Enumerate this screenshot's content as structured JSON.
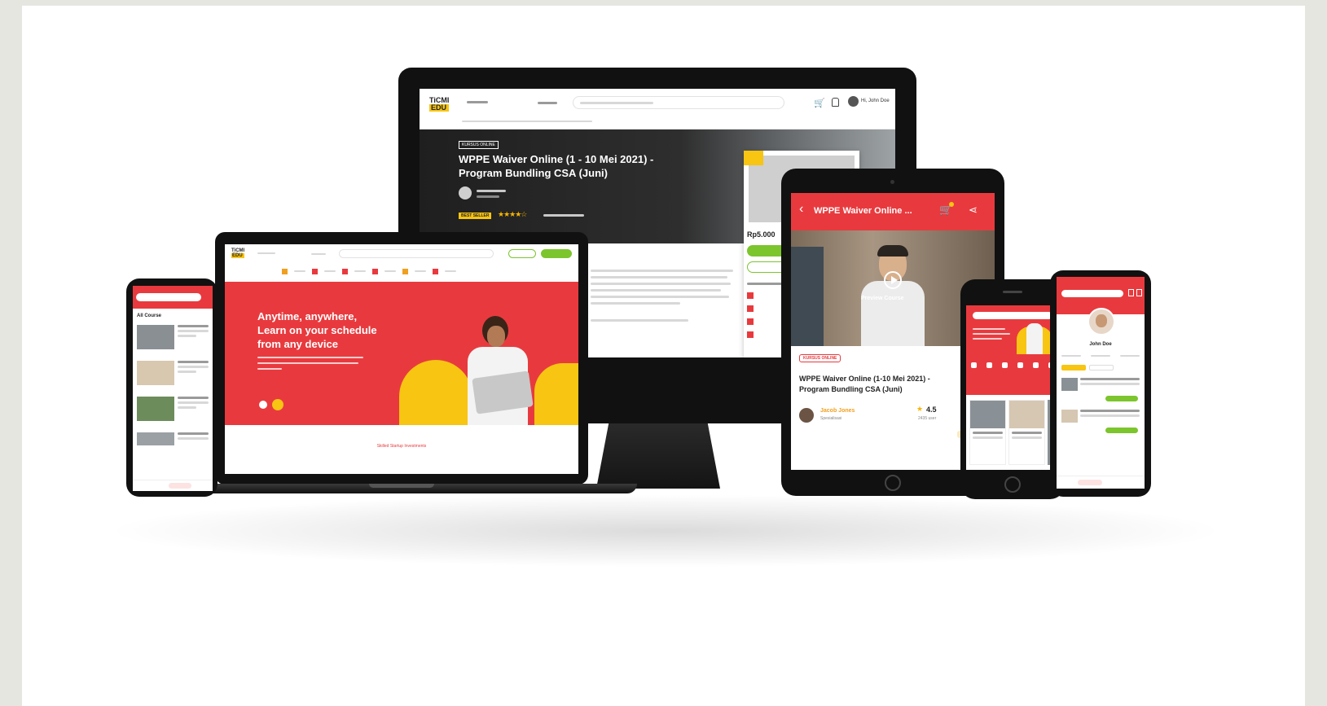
{
  "colors": {
    "brand_red": "#e83a3e",
    "brand_yellow": "#f7c512",
    "cta_green": "#7cc52d",
    "device_black": "#111111"
  },
  "desktop": {
    "logo_line1": "TiCMI",
    "logo_line2": "EDU",
    "badge": "KURSUS ONLINE",
    "course_title_line1": "WPPE Waiver Online (1 - 10 Mei 2021) -",
    "course_title_line2": "Program Bundling CSA (Juni)",
    "best_seller": "BEST SELLER",
    "price": "Rp5.000",
    "user_name": "Hi, John Doe"
  },
  "laptop": {
    "logo_line1": "TiCMI",
    "logo_line2": "EDU",
    "hero_line1": "Anytime, anywhere,",
    "hero_line2": "Learn on your schedule",
    "hero_line3": "from any device",
    "footer_link": "Skilled Startup Investments"
  },
  "left_phone": {
    "title": "All Course"
  },
  "tablet": {
    "header_title": "WPPE Waiver Online ...",
    "preview_label": "Preview Course",
    "badge": "KURSUS ONLINE",
    "course_title_line1": "WPPE Waiver Online (1-10 Mei 2021) -",
    "course_title_line2": "Program Bundling CSA (Juni)",
    "instructor_name": "Jacob Jones",
    "instructor_role": "Spesialisasi",
    "rating": "4.5",
    "rating_count": "2435 user"
  },
  "right_phone": {
    "profile_name": "John Doe"
  }
}
